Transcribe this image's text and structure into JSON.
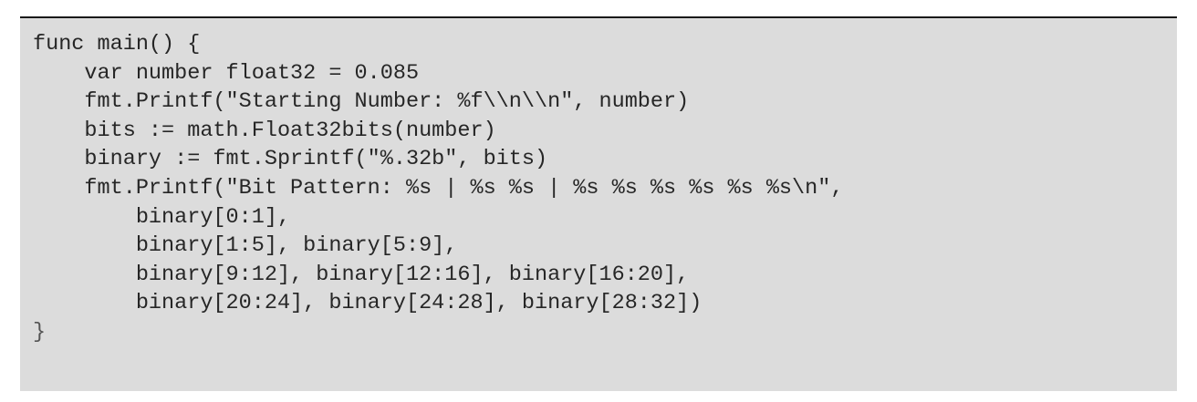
{
  "code": {
    "language": "go",
    "lines": [
      "func main() {",
      "    var number float32 = 0.085",
      "    fmt.Printf(\"Starting Number: %f\\\\n\\\\n\", number)",
      "    bits := math.Float32bits(number)",
      "    binary := fmt.Sprintf(\"%.32b\", bits)",
      "    fmt.Printf(\"Bit Pattern: %s | %s %s | %s %s %s %s %s %s\\n\",",
      "        binary[0:1],",
      "        binary[1:5], binary[5:9],",
      "        binary[9:12], binary[12:16], binary[16:20],",
      "        binary[20:24], binary[24:28], binary[28:32])",
      "}"
    ]
  },
  "colors": {
    "background": "#dcdcdc",
    "text": "#262626",
    "rule": "#1a1a1a"
  }
}
